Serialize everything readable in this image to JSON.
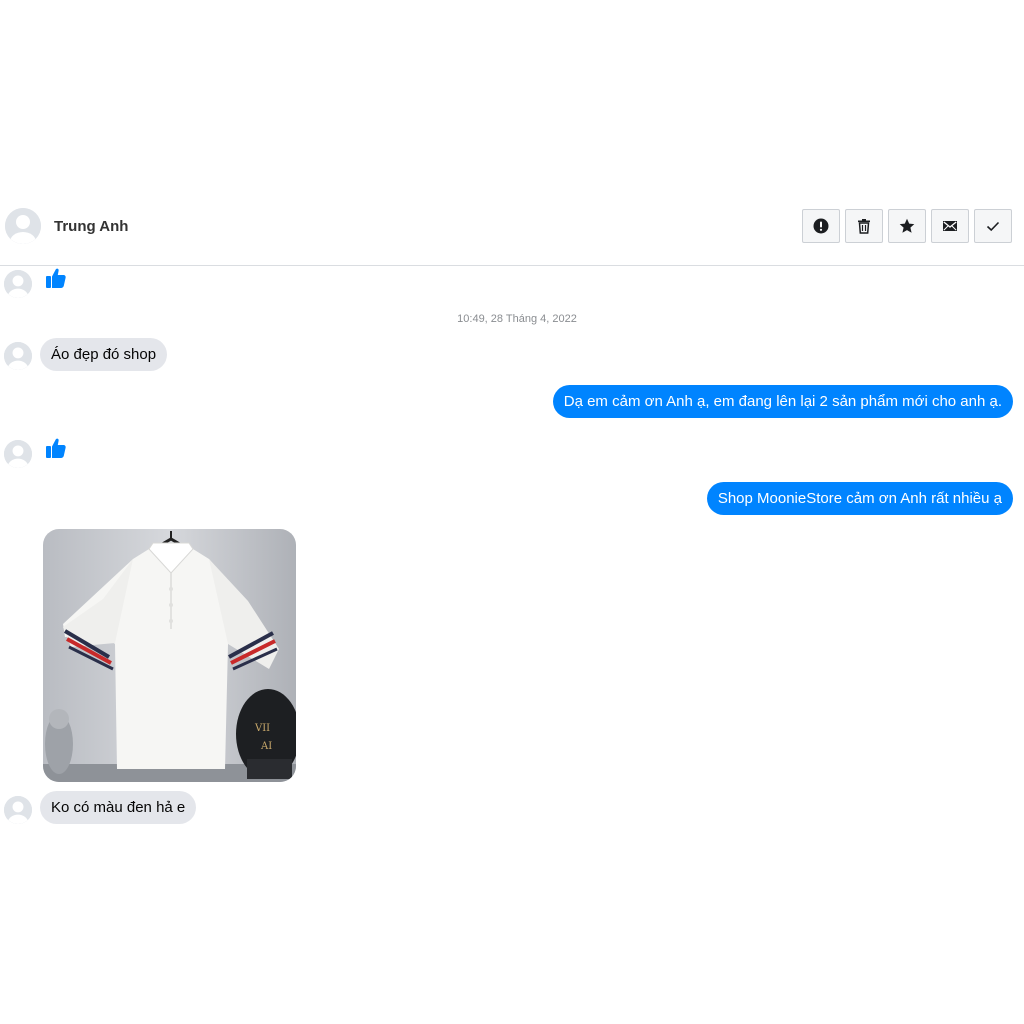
{
  "header": {
    "contact_name": "Trung Anh",
    "actions": [
      {
        "name": "report-button",
        "icon": "exclamation-icon"
      },
      {
        "name": "delete-button",
        "icon": "trash-icon"
      },
      {
        "name": "star-button",
        "icon": "star-icon"
      },
      {
        "name": "mark-unread-button",
        "icon": "envelope-icon"
      },
      {
        "name": "mark-done-button",
        "icon": "check-icon"
      }
    ]
  },
  "conversation": {
    "timestamp": "10:49, 28 Tháng 4, 2022",
    "messages": [
      {
        "sender": "contact",
        "type": "like",
        "icon": "thumbs-up-icon"
      },
      {
        "sender": "contact",
        "type": "text",
        "text": "Áo đẹp đó shop"
      },
      {
        "sender": "shop",
        "type": "text",
        "text": "Dạ em cảm ơn Anh ạ, em đang lên lại 2 sản phẩm mới cho anh ạ."
      },
      {
        "sender": "contact",
        "type": "like",
        "icon": "thumbs-up-icon"
      },
      {
        "sender": "shop",
        "type": "text",
        "text": "Shop MoonieStore cảm ơn Anh rất nhiều ạ"
      },
      {
        "sender": "contact",
        "type": "image",
        "description_icon": "polo-shirt-photo"
      },
      {
        "sender": "contact",
        "type": "text",
        "text": "Ko có màu đen hả e"
      }
    ]
  },
  "colors": {
    "outgoing_bubble": "#0084ff",
    "incoming_bubble": "#e4e6eb",
    "like": "#0084ff"
  }
}
